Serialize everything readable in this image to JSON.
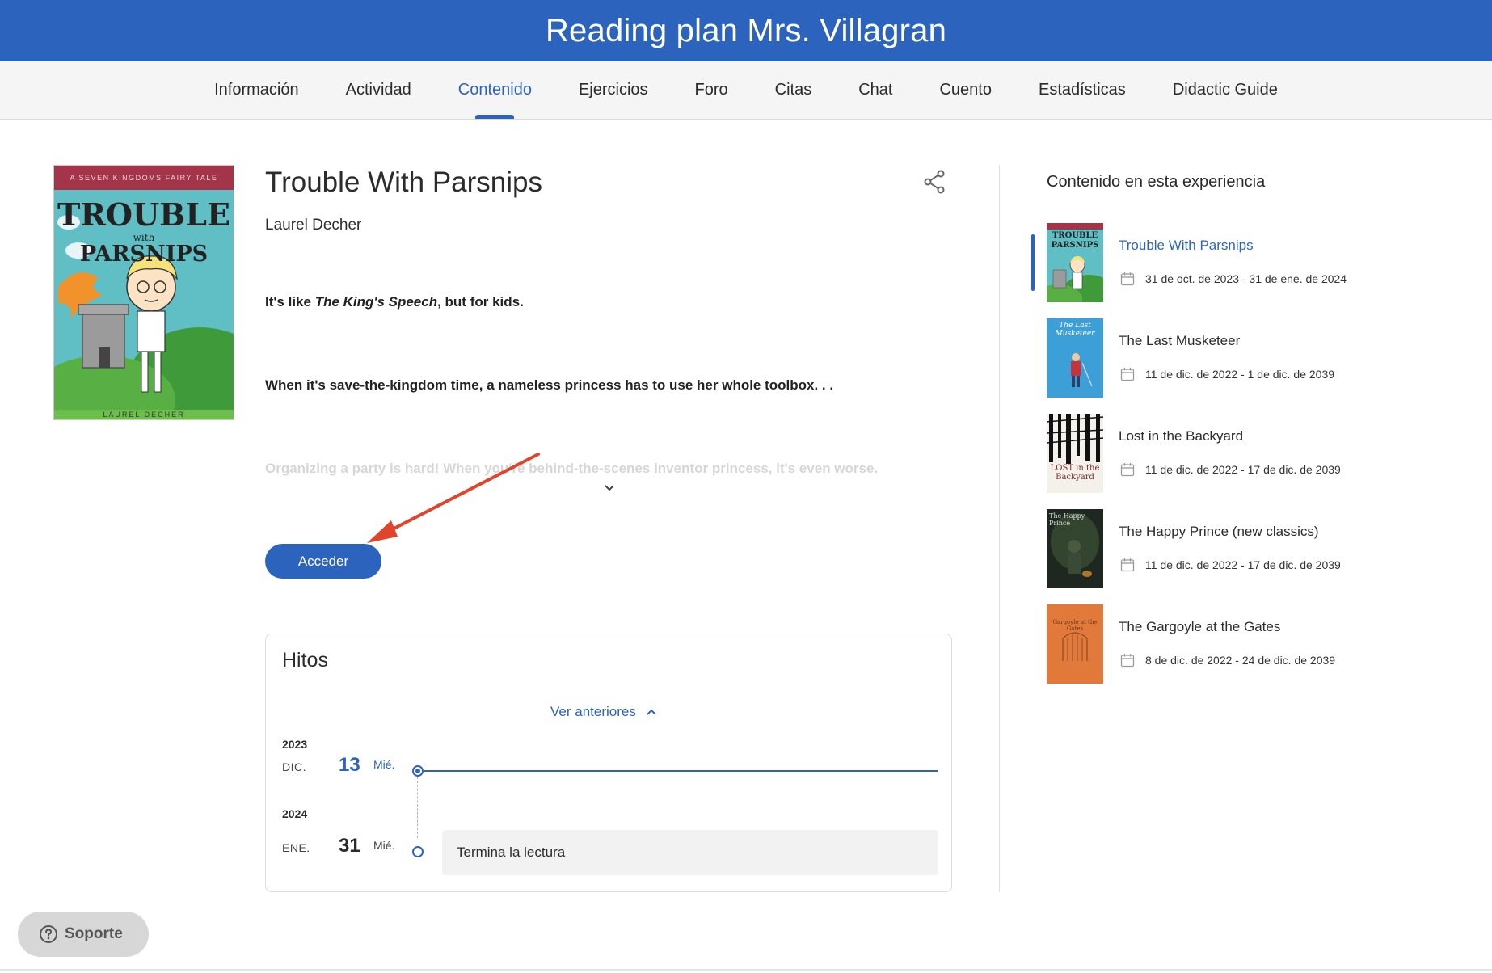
{
  "header": {
    "title": "Reading plan Mrs. Villagran"
  },
  "tabs": [
    {
      "label": "Información",
      "active": false
    },
    {
      "label": "Actividad",
      "active": false
    },
    {
      "label": "Contenido",
      "active": true
    },
    {
      "label": "Ejercicios",
      "active": false
    },
    {
      "label": "Foro",
      "active": false
    },
    {
      "label": "Citas",
      "active": false
    },
    {
      "label": "Chat",
      "active": false
    },
    {
      "label": "Cuento",
      "active": false
    },
    {
      "label": "Estadísticas",
      "active": false
    },
    {
      "label": "Didactic Guide",
      "active": false
    }
  ],
  "book": {
    "cover": {
      "series": "A SEVEN KINGDOMS FAIRY TALE",
      "title_line1": "TROUBLE",
      "title_with": "with",
      "title_line2": "PARSNIPS",
      "author_caps": "LAUREL DECHER"
    },
    "title": "Trouble With Parsnips",
    "author": "Laurel Decher",
    "desc1_prefix": "It's like ",
    "desc1_em": "The King's Speech",
    "desc1_suffix": ", but for kids.",
    "desc2": "When it's save-the-kingdom time, a nameless princess has to use her whole toolbox. . .",
    "desc3": "Organizing a party is hard! When you're behind-the-scenes inventor princess, it's even worse.",
    "access_label": "Acceder"
  },
  "milestones": {
    "title": "Hitos",
    "show_previous": "Ver anteriores",
    "entries": [
      {
        "year": "2023",
        "month": "DIC.",
        "day": "13",
        "weekday": "Mié.",
        "current": true
      },
      {
        "year": "2024",
        "month": "ENE.",
        "day": "31",
        "weekday": "Mié.",
        "current": false,
        "event": "Termina la lectura"
      }
    ]
  },
  "sidebar": {
    "title": "Contenido en esta experiencia",
    "items": [
      {
        "title": "Trouble With Parsnips",
        "dates": "31 de oct. de 2023 - 31 de ene. de 2024",
        "active": true,
        "thumb_text": "TROUBLE PARSNIPS"
      },
      {
        "title": "The Last Musketeer",
        "dates": "11 de dic. de 2022 - 1 de dic. de 2039",
        "active": false,
        "thumb_text": "The Last Musketeer"
      },
      {
        "title": "Lost in the Backyard",
        "dates": "11 de dic. de 2022 - 17 de dic. de 2039",
        "active": false,
        "thumb_text": "LOST in the Backyard"
      },
      {
        "title": "The Happy Prince (new classics)",
        "dates": "11 de dic. de 2022 - 17 de dic. de 2039",
        "active": false,
        "thumb_text": "The Happy Prince"
      },
      {
        "title": "The Gargoyle at the Gates",
        "dates": "8 de dic. de 2022 - 24 de dic. de 2039",
        "active": false,
        "thumb_text": "Gargoyle at the Gates"
      }
    ]
  },
  "support": {
    "label": "Soporte"
  },
  "colors": {
    "primary": "#2c64bd",
    "annotation_arrow": "#e0452c"
  }
}
